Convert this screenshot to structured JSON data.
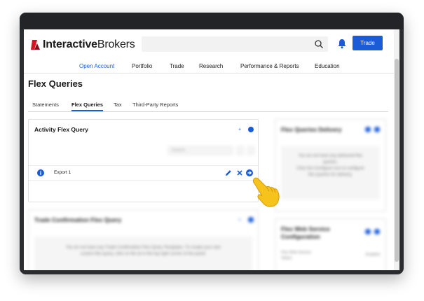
{
  "header": {
    "logo_text_bold": "Interactive",
    "logo_text_rest": "Brokers",
    "trade_label": "Trade",
    "search_placeholder": ""
  },
  "nav": {
    "items": [
      "Open Account",
      "Portfolio",
      "Trade",
      "Research",
      "Performance & Reports",
      "Education"
    ],
    "active": "Open Account"
  },
  "page": {
    "title": "Flex Queries"
  },
  "tabs": {
    "items": [
      "Statements",
      "Flex Queries",
      "Tax",
      "Third-Party Reports"
    ],
    "active": "Flex Queries"
  },
  "activity_panel": {
    "title": "Activity Flex Query",
    "search_placeholder": "Search",
    "rows": [
      {
        "label": "Export 1"
      }
    ]
  },
  "trade_panel": {
    "title": "Trade Confirmation Flex Query",
    "empty_text_line1": "You do not have any Trade Confirmation Flex Query Templates. To create your own",
    "empty_text_line2": "custom flex query, click on the ⊕ in the top right corner of the panel."
  },
  "delivery_panel": {
    "title": "Flex Queries Delivery",
    "text_lines": [
      "You do not have any delivered flex",
      "queries.",
      "Click the Configure icon to configure",
      "flex queries for delivery."
    ]
  },
  "webservice_panel": {
    "title_line1": "Flex Web Service",
    "title_line2": "Configuration",
    "status_label_line1": "Flex Web Service",
    "status_label_line2": "Status",
    "status_value": "Enabled"
  },
  "colors": {
    "accent": "#1a5bd6",
    "logo_red": "#d81222",
    "frame": "#2b2c30"
  },
  "icons": [
    "search-icon",
    "bell-icon",
    "info-icon",
    "pencil-icon",
    "close-icon",
    "arrow-right-circle-icon",
    "pointing-hand-icon"
  ]
}
